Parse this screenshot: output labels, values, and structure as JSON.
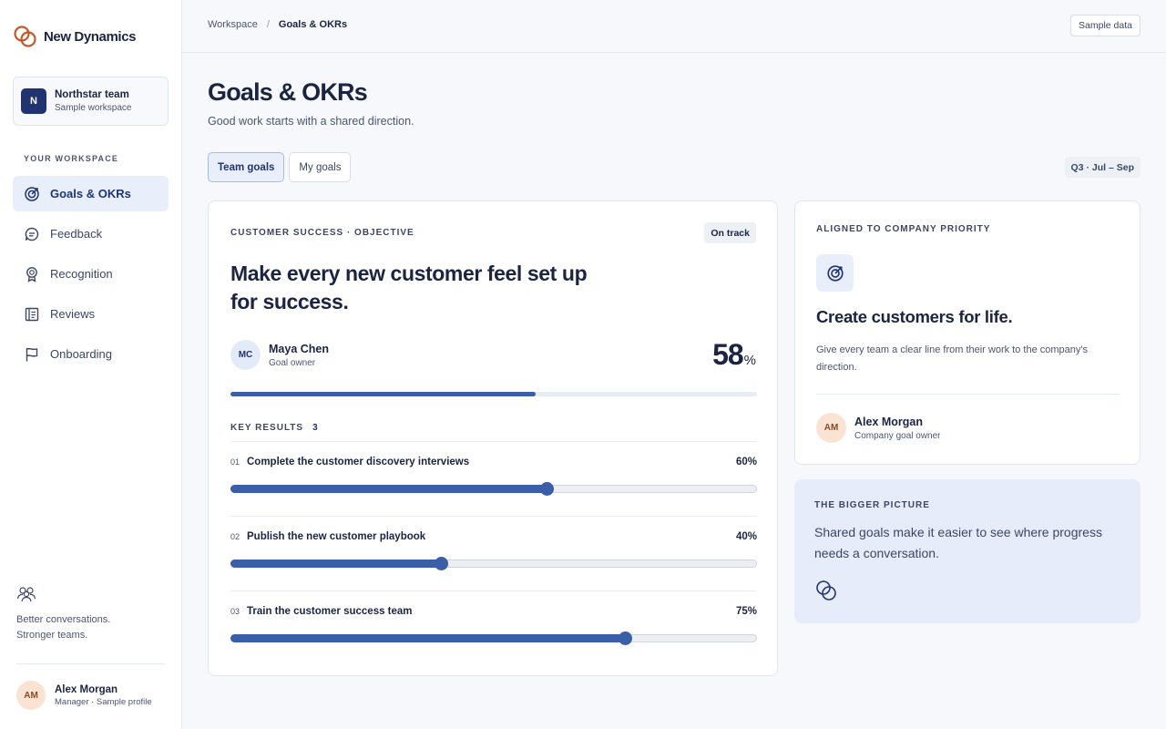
{
  "brand": {
    "name": "New Dynamics",
    "icon": "linked-rings-logo",
    "accent": "#c45a2a"
  },
  "team": {
    "initial": "N",
    "name": "Northstar team",
    "subtitle": "Sample workspace"
  },
  "sidebar": {
    "section_label": "YOUR WORKSPACE",
    "items": [
      {
        "label": "Goals & OKRs",
        "icon": "target-icon",
        "active": true
      },
      {
        "label": "Feedback",
        "icon": "chat-bubble-icon",
        "active": false
      },
      {
        "label": "Recognition",
        "icon": "award-ribbon-icon",
        "active": false
      },
      {
        "label": "Reviews",
        "icon": "document-icon",
        "active": false
      },
      {
        "label": "Onboarding",
        "icon": "flag-icon",
        "active": false
      }
    ],
    "tagline_line1": "Better conversations.",
    "tagline_line2": "Stronger teams.",
    "tagline_icon": "people-icon",
    "profile": {
      "initials": "AM",
      "name": "Alex Morgan",
      "subtitle": "Manager · Sample profile"
    }
  },
  "topbar": {
    "breadcrumb": {
      "root": "Workspace",
      "separator": "/",
      "current": "Goals & OKRs"
    },
    "badge": "Sample data"
  },
  "header": {
    "title": "Goals & OKRs",
    "subtitle": "Good work starts with a shared direction.",
    "tabs": [
      {
        "label": "Team goals",
        "active": true
      },
      {
        "label": "My goals",
        "active": false
      }
    ],
    "quarter": "Q3 · Jul – Sep"
  },
  "objective": {
    "eyebrow": "CUSTOMER SUCCESS · OBJECTIVE",
    "status": "On track",
    "title": "Make every new customer feel set up for success.",
    "owner": {
      "initials": "MC",
      "name": "Maya Chen",
      "role": "Goal owner"
    },
    "progress_value": "58",
    "progress_sign": "%",
    "progress_fraction": 0.58,
    "key_results_label": "KEY RESULTS",
    "key_results_count": "3",
    "key_results": [
      {
        "num": "01",
        "title": "Complete the customer discovery interviews",
        "percent_label": "60%",
        "fraction": 0.6
      },
      {
        "num": "02",
        "title": "Publish the new customer playbook",
        "percent_label": "40%",
        "fraction": 0.4
      },
      {
        "num": "03",
        "title": "Train the customer success team",
        "percent_label": "75%",
        "fraction": 0.75
      }
    ]
  },
  "priority": {
    "eyebrow": "ALIGNED TO COMPANY PRIORITY",
    "icon": "target-icon",
    "title": "Create customers for life.",
    "description": "Give every team a clear line from their work to the company's direction.",
    "owner": {
      "initials": "AM",
      "name": "Alex Morgan",
      "role": "Company goal owner"
    }
  },
  "bigger_picture": {
    "eyebrow": "THE BIGGER PICTURE",
    "text": "Shared goals make it easier to see where progress needs a conversation.",
    "icon": "linked-rings-icon"
  },
  "colors": {
    "primary": "#1f3470",
    "progress": "#3b5ea8",
    "active_bg": "#e9eefb",
    "bigger_picture_bg": "#e6ecfa",
    "avatar_warm": "#fbe3d3"
  }
}
